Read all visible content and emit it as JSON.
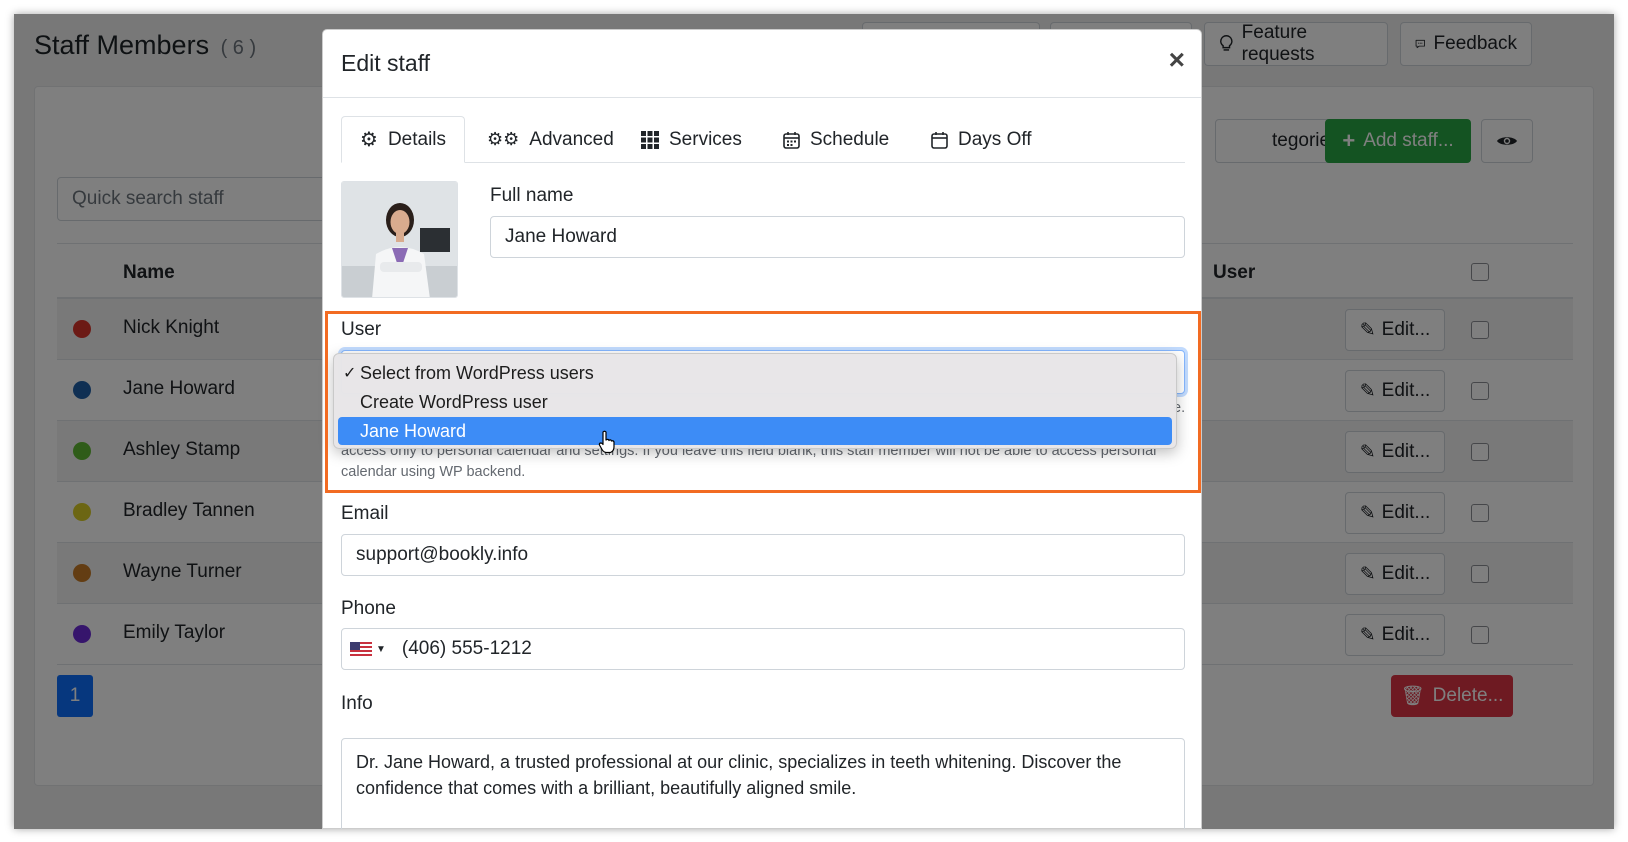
{
  "page": {
    "title": "Staff Members",
    "count": "( 6 )",
    "top_buttons": [
      "Feature requests",
      "Feedback"
    ],
    "search_placeholder": "Quick search staff",
    "categories_label": "tegories...",
    "add_staff_label": "Add staff...",
    "columns": {
      "name": "Name",
      "user": "User"
    },
    "staff": [
      {
        "name": "Nick Knight",
        "color": "#d9342b"
      },
      {
        "name": "Jane Howard",
        "color": "#1f5fa6"
      },
      {
        "name": "Ashley Stamp",
        "color": "#5fb832"
      },
      {
        "name": "Bradley Tannen",
        "color": "#d8cc26"
      },
      {
        "name": "Wayne Turner",
        "color": "#c67a26"
      },
      {
        "name": "Emily Taylor",
        "color": "#6c2bd9"
      }
    ],
    "edit_label": "Edit...",
    "page_number": "1",
    "delete_label": "Delete..."
  },
  "modal": {
    "title": "Edit staff",
    "close": "×",
    "tabs": [
      "Details",
      "Advanced",
      "Services",
      "Schedule",
      "Days Off"
    ],
    "full_name_label": "Full name",
    "full_name_value": "Jane Howard",
    "user_label": "User",
    "user_options": [
      {
        "label": "Select from WordPress users",
        "checked": true
      },
      {
        "label": "Create WordPress user",
        "checked": false
      },
      {
        "label": "Jane Howard",
        "checked": false
      }
    ],
    "user_help_tail": "e.",
    "user_help": "access only to personal calendar and settings. If you leave this field blank, this staff member will not be able to access personal calendar using WP backend.",
    "email_label": "Email",
    "email_value": "support@bookly.info",
    "phone_label": "Phone",
    "phone_value": "(406) 555-1212",
    "info_label": "Info",
    "info_value": "Dr. Jane Howard, a trusted professional at our clinic, specializes in teeth whitening. Discover the confidence that comes with a brilliant, beautifully aligned smile."
  },
  "colors": {
    "highlight": "#f26b22",
    "selected_option": "#3d8cf6",
    "add_button": "#28a745",
    "delete_button": "#dc3545",
    "primary": "#0d6efd"
  }
}
